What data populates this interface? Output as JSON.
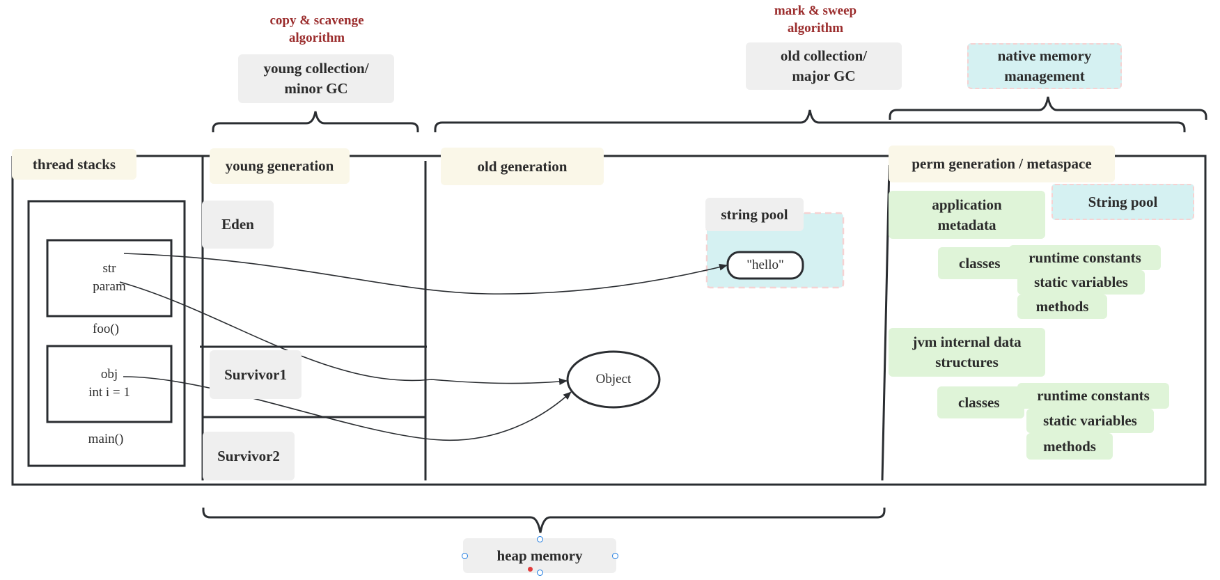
{
  "annotations": {
    "young_algorithm": "copy & scavenge algorithm",
    "old_algorithm": "mark & sweep algorithm"
  },
  "collections": {
    "young": "young collection/ minor GC",
    "old": "old collection/ major GC",
    "native": "native memory management"
  },
  "regions": {
    "thread_stacks": "thread stacks",
    "young_generation": "young generation",
    "old_generation": "old generation",
    "perm_generation": "perm generation / metaspace"
  },
  "thread_stacks": {
    "frames": [
      {
        "vars": [
          "str",
          "param"
        ],
        "label": "foo()"
      },
      {
        "vars": [
          "obj",
          "int i = 1"
        ],
        "label": "main()"
      }
    ]
  },
  "young_generation": {
    "spaces": [
      "Eden",
      "Survivor1",
      "Survivor2"
    ]
  },
  "old_generation": {
    "string_pool": "string pool",
    "hello": "\"hello\"",
    "object": "Object"
  },
  "perm_generation": {
    "application_metadata": "application metadata",
    "string_pool": "String pool",
    "jvm_internal": "jvm internal data structures",
    "groups": [
      {
        "classes": "classes",
        "items": [
          "runtime constants",
          "static variables",
          "methods"
        ]
      },
      {
        "classes": "classes",
        "items": [
          "runtime constants",
          "static variables",
          "methods"
        ]
      }
    ]
  },
  "heap": {
    "label": "heap memory"
  },
  "colors": {
    "annotation": "#9b2d2d",
    "region_label": "#faf7e8",
    "gray_node": "#efefef",
    "green_node": "#dff4d8",
    "cyan_node": "#d5f1f2",
    "dashed_border": "#f6d2d2",
    "line": "#2a2d31",
    "selection_handle": "#1e7be0"
  }
}
